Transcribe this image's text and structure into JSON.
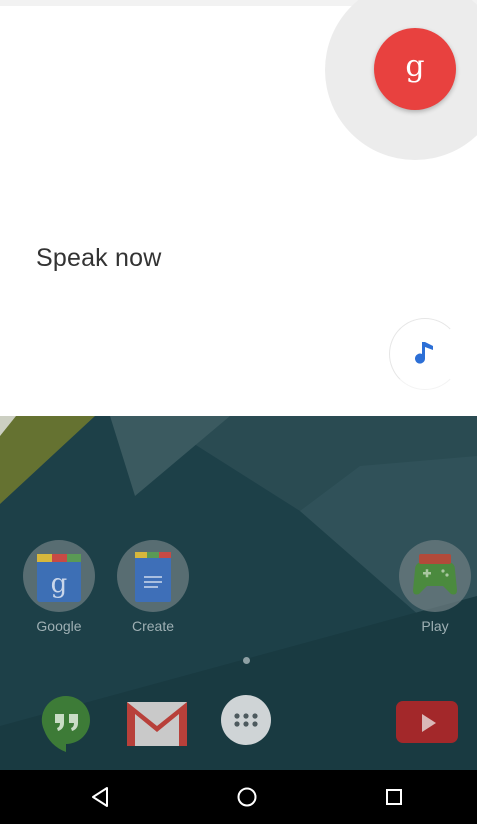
{
  "voice_search": {
    "prompt": "Speak now",
    "mic_glyph": "g",
    "mic_icon": "google-voice-mic-icon",
    "music_icon": "music-note-icon",
    "accent_color": "#e8413f",
    "music_color": "#2c6fd6"
  },
  "home": {
    "apps": [
      {
        "label": "Google",
        "icon": "google-search-icon"
      },
      {
        "label": "Create",
        "icon": "google-docs-icon"
      },
      {
        "label": "Play",
        "icon": "google-play-games-icon"
      }
    ],
    "dock": [
      {
        "icon": "hangouts-icon"
      },
      {
        "icon": "gmail-icon"
      },
      {
        "icon": "app-drawer-icon"
      },
      {
        "icon": "youtube-icon"
      }
    ],
    "page_indicator": {
      "current": 1,
      "total": 1
    }
  },
  "nav_bar": {
    "buttons": [
      "back-icon",
      "home-icon",
      "recents-icon"
    ]
  }
}
